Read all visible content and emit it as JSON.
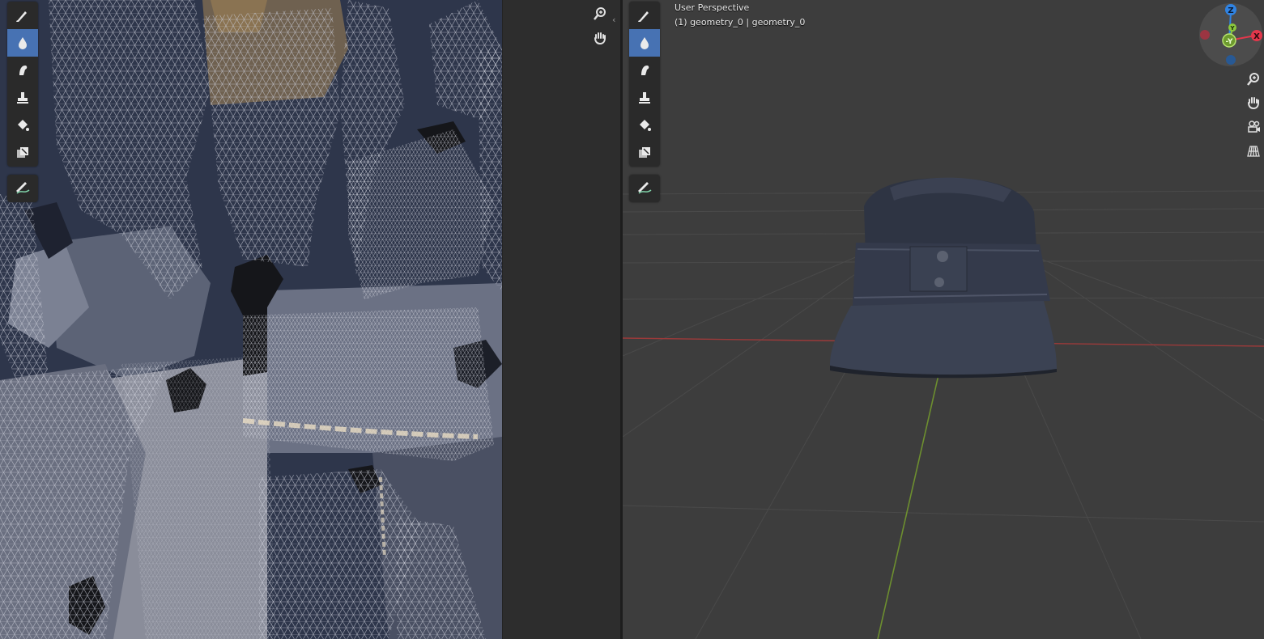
{
  "viewport": {
    "view_name": "User Perspective",
    "object_info": "(1) geometry_0 | geometry_0"
  },
  "gizmo": {
    "axes": {
      "z": "Z",
      "x": "X",
      "neg_y": "-Y",
      "y": "Y"
    },
    "colors": {
      "x": "#e3374b",
      "y": "#8bc83d",
      "z": "#2f83e3"
    }
  },
  "icons": {
    "uv_tools": [
      "draw-brush-icon",
      "soften-brush-icon",
      "smear-brush-icon",
      "clone-stamp-icon",
      "fill-bucket-icon",
      "mask-icon"
    ],
    "uv_annotate": "annotate-icon",
    "uv_nav": [
      "zoom-icon",
      "pan-hand-icon"
    ],
    "vp_tools": [
      "draw-brush-icon",
      "soften-brush-icon",
      "smear-brush-icon",
      "clone-stamp-icon",
      "fill-bucket-icon",
      "mask-icon"
    ],
    "vp_annotate": "annotate-icon",
    "vp_nav": [
      "zoom-icon",
      "pan-hand-icon",
      "camera-view-icon",
      "perspective-grid-icon"
    ]
  },
  "active_tool": "soften-brush-icon",
  "colors": {
    "active_tool_bg": "#4772b3",
    "viewport_bg": "#3d3d3d",
    "x_axis_line": "#9b3a3a",
    "y_axis_line": "#6d8f2f"
  }
}
